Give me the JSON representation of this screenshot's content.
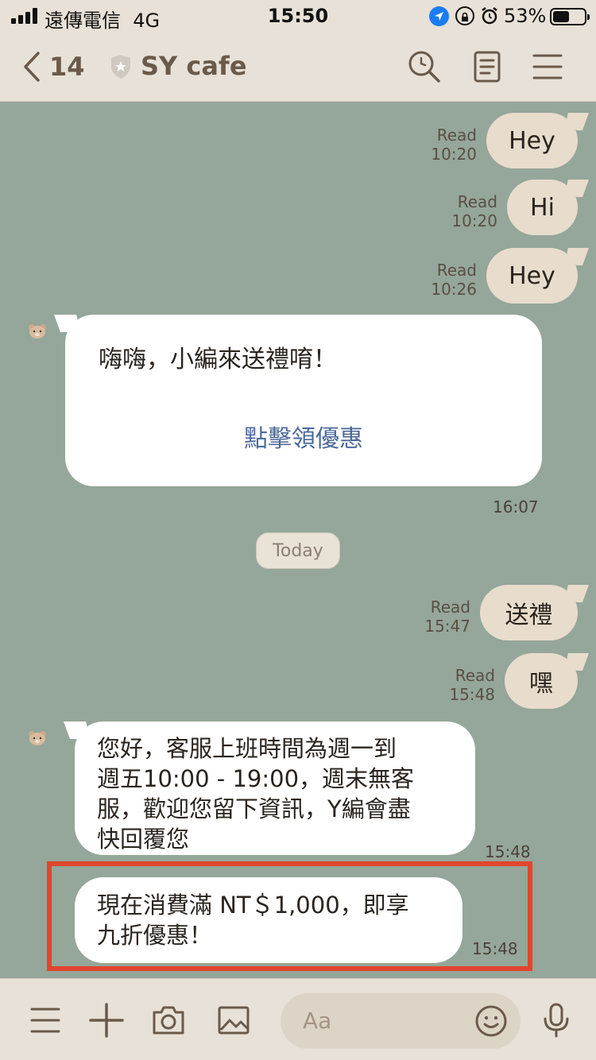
{
  "status": {
    "carrier": "遠傳電信",
    "network": "4G",
    "time": "15:50",
    "battery_pct": "53%",
    "battery_level": 0.53
  },
  "header": {
    "back_count": "14",
    "title": "SY cafe"
  },
  "messages": [
    {
      "dir": "out",
      "status": "Read",
      "time": "10:20",
      "text": "Hey"
    },
    {
      "dir": "out",
      "status": "Read",
      "time": "10:20",
      "text": "Hi"
    },
    {
      "dir": "out",
      "status": "Read",
      "time": "10:26",
      "text": "Hey"
    },
    {
      "dir": "in",
      "type": "card",
      "text": "嗨嗨，小編來送禮唷！",
      "link": "點擊領優惠",
      "time": "16:07"
    },
    {
      "dir": "out",
      "status": "Read",
      "time": "15:47",
      "text": "送禮"
    },
    {
      "dir": "out",
      "status": "Read",
      "time": "15:48",
      "text": "嘿"
    },
    {
      "dir": "in",
      "lines": [
        "您好，客服上班時間為週一到",
        "週五10:00 - 19:00，週末無客",
        "服，歡迎您留下資訊，Y編會盡",
        "快回覆您"
      ],
      "time": "15:48"
    },
    {
      "dir": "in",
      "lines": [
        "現在消費滿 NT＄1,000，即享",
        "九折優惠！"
      ],
      "time": "15:48"
    }
  ],
  "date_divider": "Today",
  "composer": {
    "placeholder": "Aa"
  },
  "colors": {
    "chat_bg": "#95a69a",
    "bar_bg": "#e8e1d7",
    "outgoing_bubble": "#e8dccc",
    "incoming_bubble": "#ffffff",
    "link": "#4b6a9b",
    "highlight": "#e2452e"
  }
}
